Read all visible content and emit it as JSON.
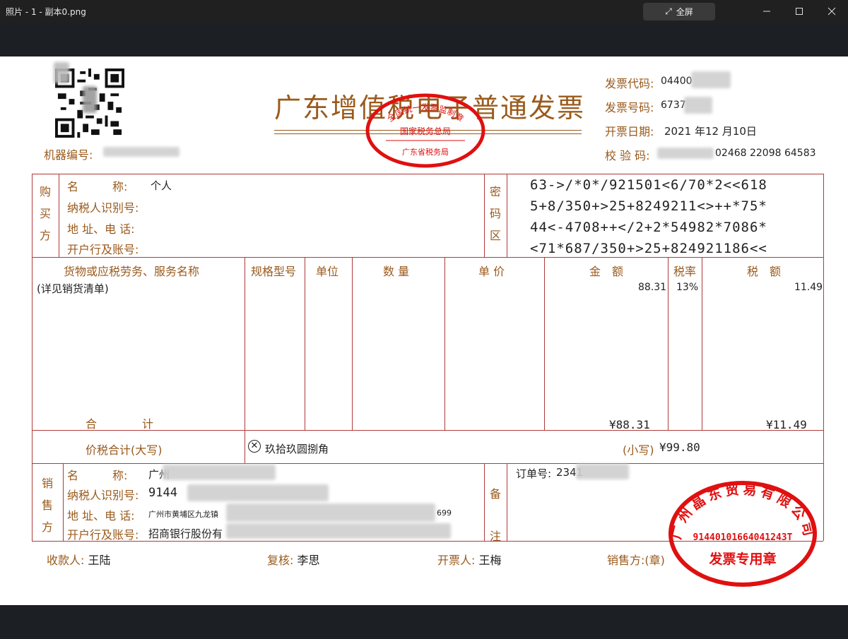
{
  "window": {
    "title": "照片 - 1 - 副本0.png",
    "fullscreen_label": "全屏"
  },
  "invoice": {
    "title": "广东增值税电子普通发票",
    "machine_no_label": "机器编号:",
    "code_label": "发票代码:",
    "code_value": "04400",
    "number_label": "发票号码:",
    "number_value": "6737",
    "date_label": "开票日期:",
    "date_value": "2021 年12 月10日",
    "check_label": "校 验 码:",
    "check_value": "02468 22098 64583",
    "stamp_tax": {
      "top": "全国统一发票监制章",
      "mid": "国家税务总局",
      "bottom": "广东省税务局"
    },
    "buyer": {
      "side_label": [
        "购",
        "买",
        "方"
      ],
      "name_label": "名　　　称:",
      "name_value": "个人",
      "tax_id_label": "纳税人识别号:",
      "addr_label": "地 址、电 话:",
      "bank_label": "开户行及账号:"
    },
    "cipher": {
      "side_label": [
        "密",
        "码",
        "区"
      ],
      "lines": [
        "63->/*0*/921501<6/70*2<<618",
        "5+8/350+>25+8249211<>++*75*",
        "44<-4708++</2+2*54982*7086*",
        "<71*687/350+>25+824921186<<"
      ]
    },
    "items": {
      "headers": [
        "货物或应税劳务、服务名称",
        "规格型号",
        "单位",
        "数 量",
        "单 价",
        "金　额",
        "税率",
        "税　额"
      ],
      "row": {
        "name": "(详见销货清单)",
        "amount": "88.31",
        "rate": "13%",
        "tax": "11.49"
      },
      "total_label_a": "合",
      "total_label_b": "计",
      "total_amount": "¥88.31",
      "total_tax": "¥11.49"
    },
    "grand_total": {
      "label": "价税合计(大写)",
      "upper_value": "玖拾玖圆捌角",
      "small_label": "(小写)",
      "small_value": "¥99.80"
    },
    "seller": {
      "side_label": [
        "销",
        "售",
        "方"
      ],
      "name_label": "名　　　称:",
      "name_value": "广州",
      "tax_id_label": "纳税人识别号:",
      "tax_id_value": "9144",
      "addr_label": "地 址、电 话:",
      "addr_value": "广州市黄埔区九龙镇",
      "addr_tail": "699",
      "bank_label": "开户行及账号:",
      "bank_value": "招商银行股份有"
    },
    "remarks": {
      "side_label": [
        "备",
        "注"
      ],
      "order_label": "订单号:",
      "order_value": "2341"
    },
    "seller_stamp": {
      "company": "广州晶东贸易有限公司",
      "tax_no": "91440101664041243T",
      "caption": "发票专用章"
    },
    "footer": {
      "payee_label": "收款人:",
      "payee": "王陆",
      "reviewer_label": "复核:",
      "reviewer": "李思",
      "drawer_label": "开票人:",
      "drawer": "王梅",
      "seller_label": "销售方:(章)"
    }
  }
}
